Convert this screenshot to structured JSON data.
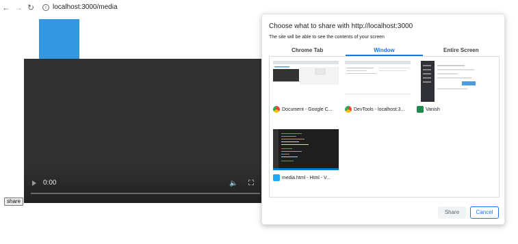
{
  "browser": {
    "back_icon": "arrow-left-icon",
    "forward_icon": "arrow-right-icon",
    "reload_icon": "reload-icon",
    "url": "localhost:3000/media"
  },
  "page": {
    "video": {
      "time": "0:00"
    },
    "share_button": "share"
  },
  "dialog": {
    "title": "Choose what to share with http://localhost:3000",
    "subtitle": "The site will be able to see the contents of your screen",
    "tabs": [
      {
        "label": "Chrome Tab",
        "active": false
      },
      {
        "label": "Window",
        "active": true
      },
      {
        "label": "Entire Screen",
        "active": false
      }
    ],
    "windows": [
      {
        "label": "Document - Google C...",
        "icon": "chrome-icon"
      },
      {
        "label": "DevTools - localhost:3...",
        "icon": "chrome-icon"
      },
      {
        "label": "Vanish",
        "icon": "vanish-app-icon"
      },
      {
        "label": "media.html - Html - V...",
        "icon": "vscode-icon"
      }
    ],
    "share_button": "Share",
    "cancel_button": "Cancel"
  },
  "colors": {
    "accent": "#1a73e8",
    "blue_box": "#3597e0",
    "video_bg": "#323232"
  }
}
